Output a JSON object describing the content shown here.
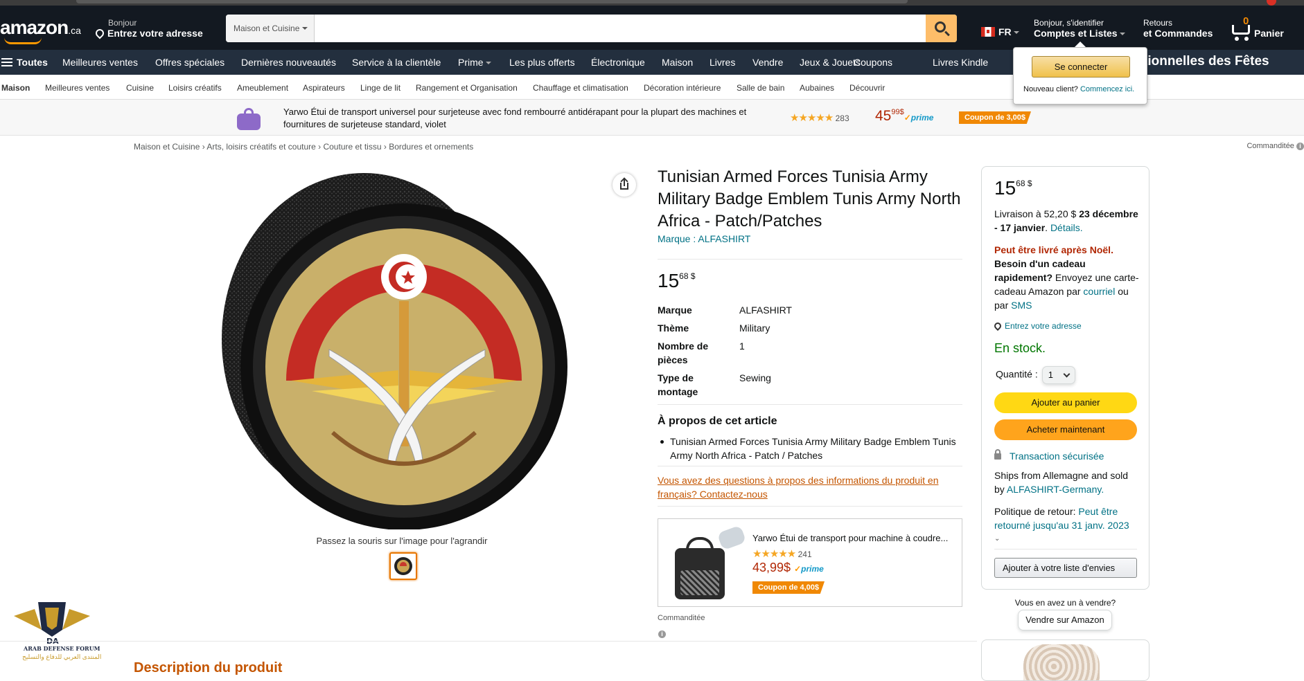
{
  "header": {
    "logo_text": "amazon",
    "logo_suffix": ".ca",
    "address_greeting": "Bonjour",
    "address_prompt": "Entrez votre adresse",
    "search_category": "Maison et Cuisine",
    "search_value": "",
    "language": "FR",
    "account_greeting": "Bonjour, s'identifier",
    "account_label": "Comptes et Listes",
    "returns_l1": "Retours",
    "returns_l2": "et Commandes",
    "cart_count": "0",
    "cart_label": "Panier"
  },
  "nav_main": {
    "all_label": "Toutes",
    "items": [
      "Meilleures ventes",
      "Offres spéciales",
      "Dernières nouveautés",
      "Service à la clientèle",
      "Prime",
      "Les plus offerts",
      "Électronique",
      "Maison",
      "Livres",
      "Vendre",
      "Jeux & Jouets",
      "Coupons",
      "Livres Kindle"
    ],
    "promo": "tionnelles des Fêtes"
  },
  "subnav": [
    "Maison",
    "Meilleures ventes",
    "Cuisine",
    "Loisirs créatifs",
    "Ameublement",
    "Aspirateurs",
    "Linge de lit",
    "Rangement et Organisation",
    "Chauffage et climatisation",
    "Décoration intérieure",
    "Salle de bain",
    "Aubaines",
    "Découvrir"
  ],
  "banner": {
    "title": "Yarwo Étui de transport universel pour surjeteuse avec fond rembourré antidérapant pour la plupart des machines et fournitures de surjeteuse standard, violet",
    "stars": "★★★★★",
    "rating_count": "283",
    "price_whole": "45",
    "price_frac": "99$",
    "prime": "prime",
    "coupon": "Coupon de 3,00$"
  },
  "breadcrumbs": [
    "Maison et Cuisine",
    "Arts, loisirs créatifs et couture",
    "Couture et tissu",
    "Bordures et ornements"
  ],
  "sponsored_label": "Commanditée",
  "image": {
    "hover_text": "Passez la souris sur l'image pour l'agrandir"
  },
  "product": {
    "title": "Tunisian Armed Forces Tunisia Army Military Badge Emblem Tunis Army North Africa - Patch/Patches",
    "brand_link": "Marque : ALFASHIRT",
    "price_whole": "15",
    "price_frac": "68 $",
    "specs": [
      {
        "k": "Marque",
        "v": "ALFASHIRT"
      },
      {
        "k": "Thème",
        "v": "Military"
      },
      {
        "k": "Nombre de pièces",
        "v": "1"
      },
      {
        "k": "Type de montage",
        "v": "Sewing"
      }
    ],
    "about_heading": "À propos de cet article",
    "about_item": "Tunisian Armed Forces Tunisia Army Military Badge Emblem Tunis Army North Africa - Patch / Patches",
    "question_link": "Vous avez des questions à propos des informations du produit en français? Contactez-nous"
  },
  "ad": {
    "title": "Yarwo Étui de transport pour machine à coudre...",
    "stars": "★★★★★",
    "rating_count": "241",
    "price": "43,99$",
    "prime": "prime",
    "coupon": "Coupon de 4,00$",
    "sponsored": "Commanditée"
  },
  "buybox": {
    "price_whole": "15",
    "price_frac": "68 $",
    "delivery_prefix": "Livraison à 52,20 $",
    "delivery_dates": "23 décembre - 17 janvier",
    "details_link": "Détails.",
    "after_noel": "Peut être livré après Noël.",
    "gift_bold": "Besoin d'un cadeau rapidement?",
    "gift_text1": "Envoyez une carte-cadeau Amazon par",
    "gift_link1": "courriel",
    "gift_text2": "ou par",
    "gift_link2": "SMS",
    "address_link": "Entrez votre adresse",
    "stock": "En stock.",
    "qty_label": "Quantité :",
    "qty_value": "1",
    "add_cart": "Ajouter au panier",
    "buy_now": "Acheter maintenant",
    "secure": "Transaction sécurisée",
    "ships_text": "Ships from Allemagne and sold by",
    "seller_link": "ALFASHIRT-Germany.",
    "return_label": "Politique de retour:",
    "return_link": "Peut être retourné jusqu'au 31 janv. 2023",
    "wishlist": "Ajouter à votre liste d'envies",
    "sell_question": "Vous en avez un à vendre?",
    "sell_button": "Vendre sur Amazon"
  },
  "signin_popover": {
    "button": "Se connecter",
    "new_customer": "Nouveau client?",
    "start_link": "Commencez ici."
  },
  "watermark": {
    "line1": "ARAB DEFENSE FORUM",
    "line2": "المنتدى العربي للدفاع والتسليح",
    "mark": "DA"
  },
  "desc_heading": "Description du produit",
  "colors": {
    "nav_dark": "#131921",
    "nav_main": "#232f3e",
    "accent_orange": "#ff9900",
    "link": "#007185",
    "price_red": "#b12704",
    "add_cart_yellow": "#ffd814",
    "buy_now_orange": "#ffa41c",
    "stock_green": "#007600"
  }
}
